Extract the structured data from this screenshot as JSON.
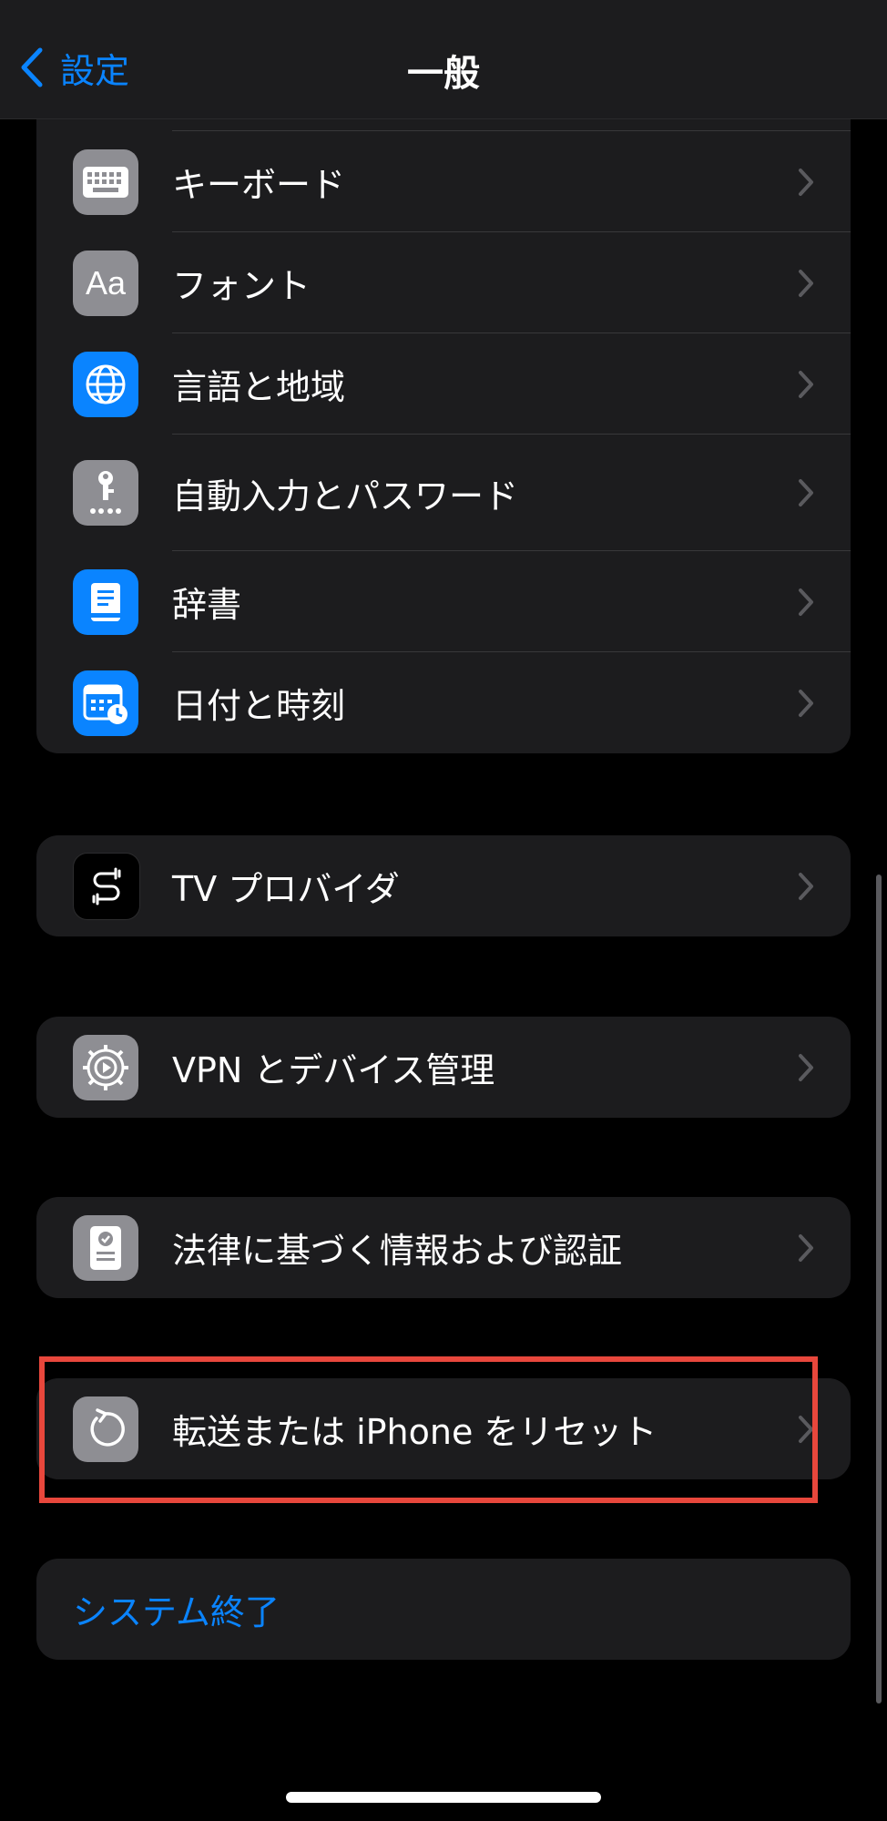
{
  "navbar": {
    "back_label": "設定",
    "title": "一般"
  },
  "group_1": {
    "items": [
      {
        "label": "キーボード",
        "icon": "keyboard-icon"
      },
      {
        "label": "フォント",
        "icon": "font-aa-icon",
        "icon_text": "Aa"
      },
      {
        "label": "言語と地域",
        "icon": "globe-icon"
      },
      {
        "label": "自動入力とパスワード",
        "icon": "key-icon"
      },
      {
        "label": "辞書",
        "icon": "book-icon"
      },
      {
        "label": "日付と時刻",
        "icon": "calendar-clock-icon"
      }
    ]
  },
  "group_2": {
    "label": "TV プロバイダ",
    "icon": "tv-provider-icon"
  },
  "group_3": {
    "label": "VPN とデバイス管理",
    "icon": "gear-icon"
  },
  "group_4": {
    "label": "法律に基づく情報および認証",
    "icon": "certificate-icon"
  },
  "group_5": {
    "label": "転送または iPhone をリセット",
    "icon": "reset-icon"
  },
  "group_6": {
    "label": "システム終了"
  },
  "colors": {
    "accent": "#0a84ff",
    "highlight": "#e8473c",
    "group_bg": "#1c1c1e"
  }
}
